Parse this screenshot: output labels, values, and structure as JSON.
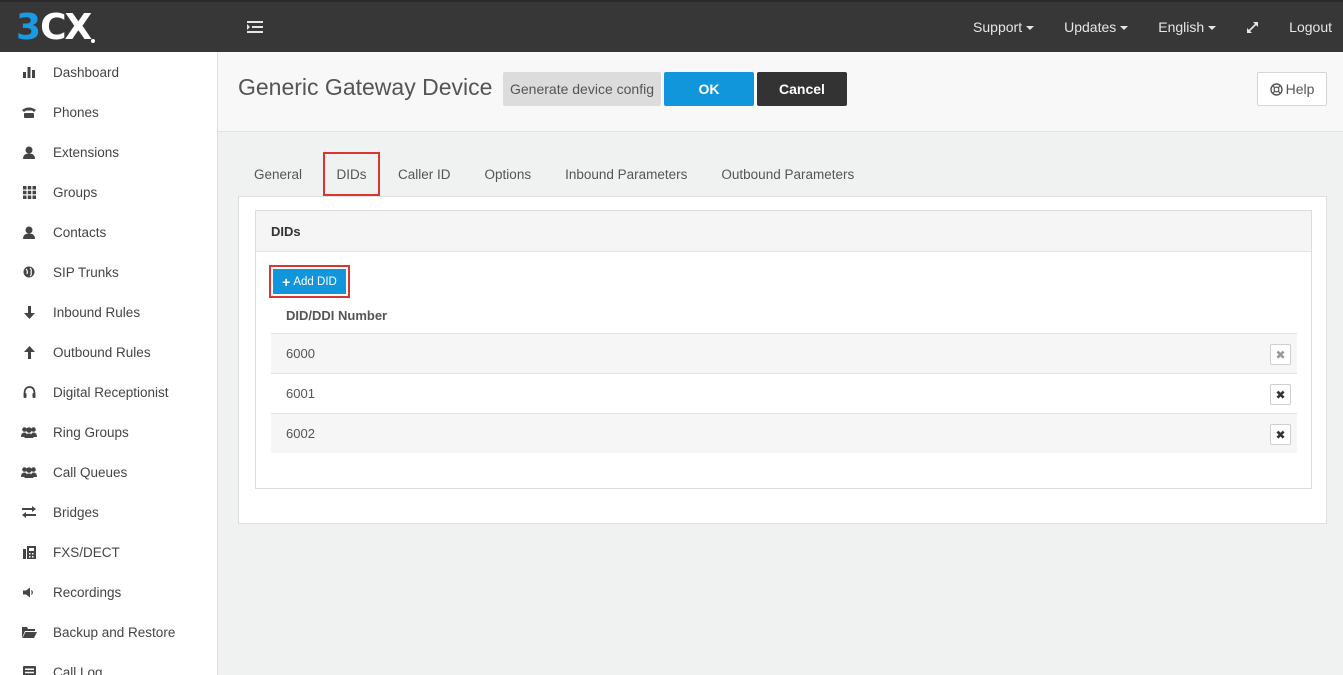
{
  "logo": {
    "part1": "3",
    "part2": "CX"
  },
  "topnav": {
    "support": "Support",
    "updates": "Updates",
    "language": "English",
    "logout": "Logout"
  },
  "sidebar": {
    "items": [
      {
        "label": "Dashboard",
        "icon": "bar-chart-icon"
      },
      {
        "label": "Phones",
        "icon": "phone-icon"
      },
      {
        "label": "Extensions",
        "icon": "user-icon"
      },
      {
        "label": "Groups",
        "icon": "grid-icon"
      },
      {
        "label": "Contacts",
        "icon": "user-icon"
      },
      {
        "label": "SIP Trunks",
        "icon": "globe-icon"
      },
      {
        "label": "Inbound Rules",
        "icon": "arrow-down-icon"
      },
      {
        "label": "Outbound Rules",
        "icon": "arrow-up-icon"
      },
      {
        "label": "Digital Receptionist",
        "icon": "headset-icon"
      },
      {
        "label": "Ring Groups",
        "icon": "users-icon"
      },
      {
        "label": "Call Queues",
        "icon": "users-icon"
      },
      {
        "label": "Bridges",
        "icon": "exchange-icon"
      },
      {
        "label": "FXS/DECT",
        "icon": "fax-icon"
      },
      {
        "label": "Recordings",
        "icon": "speaker-icon"
      },
      {
        "label": "Backup and Restore",
        "icon": "folder-icon"
      },
      {
        "label": "Call Log",
        "icon": "list-icon"
      }
    ]
  },
  "header": {
    "title": "Generic Gateway Device",
    "generate_label": "Generate device config",
    "ok_label": "OK",
    "cancel_label": "Cancel",
    "help_label": "Help"
  },
  "tabs": [
    {
      "label": "General"
    },
    {
      "label": "DIDs",
      "active": true
    },
    {
      "label": "Caller ID"
    },
    {
      "label": "Options"
    },
    {
      "label": "Inbound Parameters"
    },
    {
      "label": "Outbound Parameters"
    }
  ],
  "dids_panel": {
    "title": "DIDs",
    "add_label": "Add DID",
    "column_header": "DID/DDI Number",
    "rows": [
      {
        "number": "6000"
      },
      {
        "number": "6001"
      },
      {
        "number": "6002"
      }
    ]
  },
  "colors": {
    "accent": "#1296db",
    "topbar": "#373737",
    "highlight": "#d9362f"
  }
}
